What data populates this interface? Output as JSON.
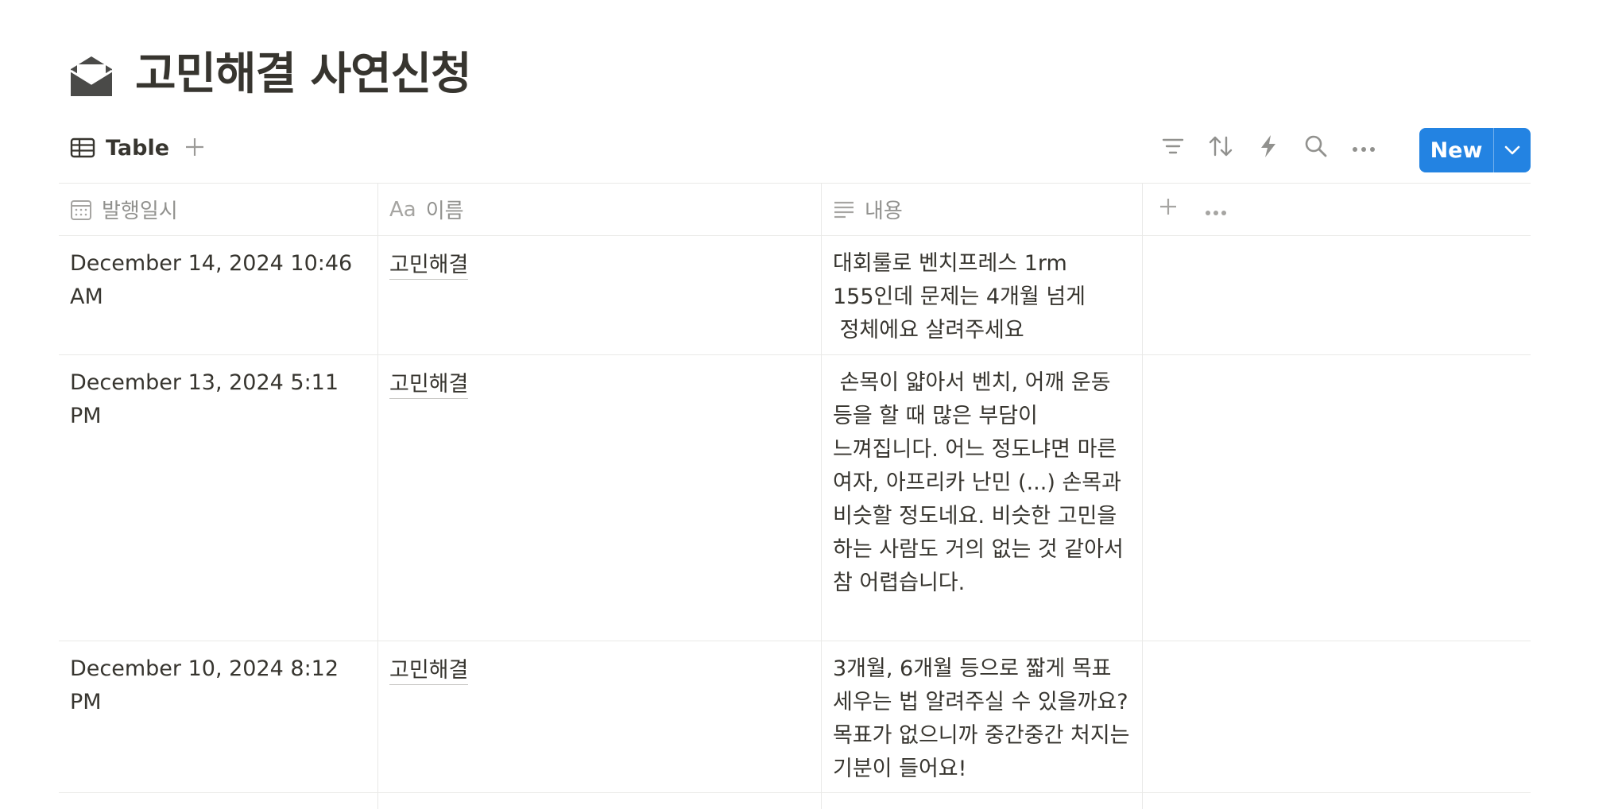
{
  "page": {
    "icon": "open-envelope-icon",
    "title": "고민해결 사연신청"
  },
  "view_bar": {
    "active_view": {
      "icon": "table-icon",
      "label": "Table"
    },
    "add_view_icon": "plus-icon",
    "toolbar_icons": [
      "filter-icon",
      "sort-icon",
      "automation-bolt-icon",
      "search-icon",
      "more-icon"
    ],
    "new_button_label": "New",
    "accent_color": "#2383e2"
  },
  "table": {
    "columns": [
      {
        "icon": "calendar-icon",
        "label": "발행일시"
      },
      {
        "icon": "aa-title-icon",
        "icon_text": "Aa",
        "label": "이름"
      },
      {
        "icon": "text-lines-icon",
        "label": "내용"
      }
    ],
    "rows": [
      {
        "date": "December 14, 2024 10:46 AM",
        "name": "고민해결",
        "content": "대회룰로 벤치프레스 1rm 155인데 문제는 4개월 넘게\n 정체에요 살려주세요"
      },
      {
        "date": "December 13, 2024 5:11 PM",
        "name": "고민해결",
        "content": " 손목이 얇아서 벤치, 어깨 운동 등을 할 때 많은 부담이 느껴집니다. 어느 정도냐면 마른 여자, 아프리카 난민 (...) 손목과 비슷할 정도네요. 비슷한 고민을 하는 사람도 거의 없는 것 같아서 참 어렵습니다."
      },
      {
        "date": "December 10, 2024 8:12 PM",
        "name": "고민해결",
        "content": "3개월, 6개월 등으로 짧게 목표 세우는 법 알려주실 수 있을까요? 목표가 없으니까 중간중간 처지는 기분이 들어요!"
      }
    ]
  }
}
